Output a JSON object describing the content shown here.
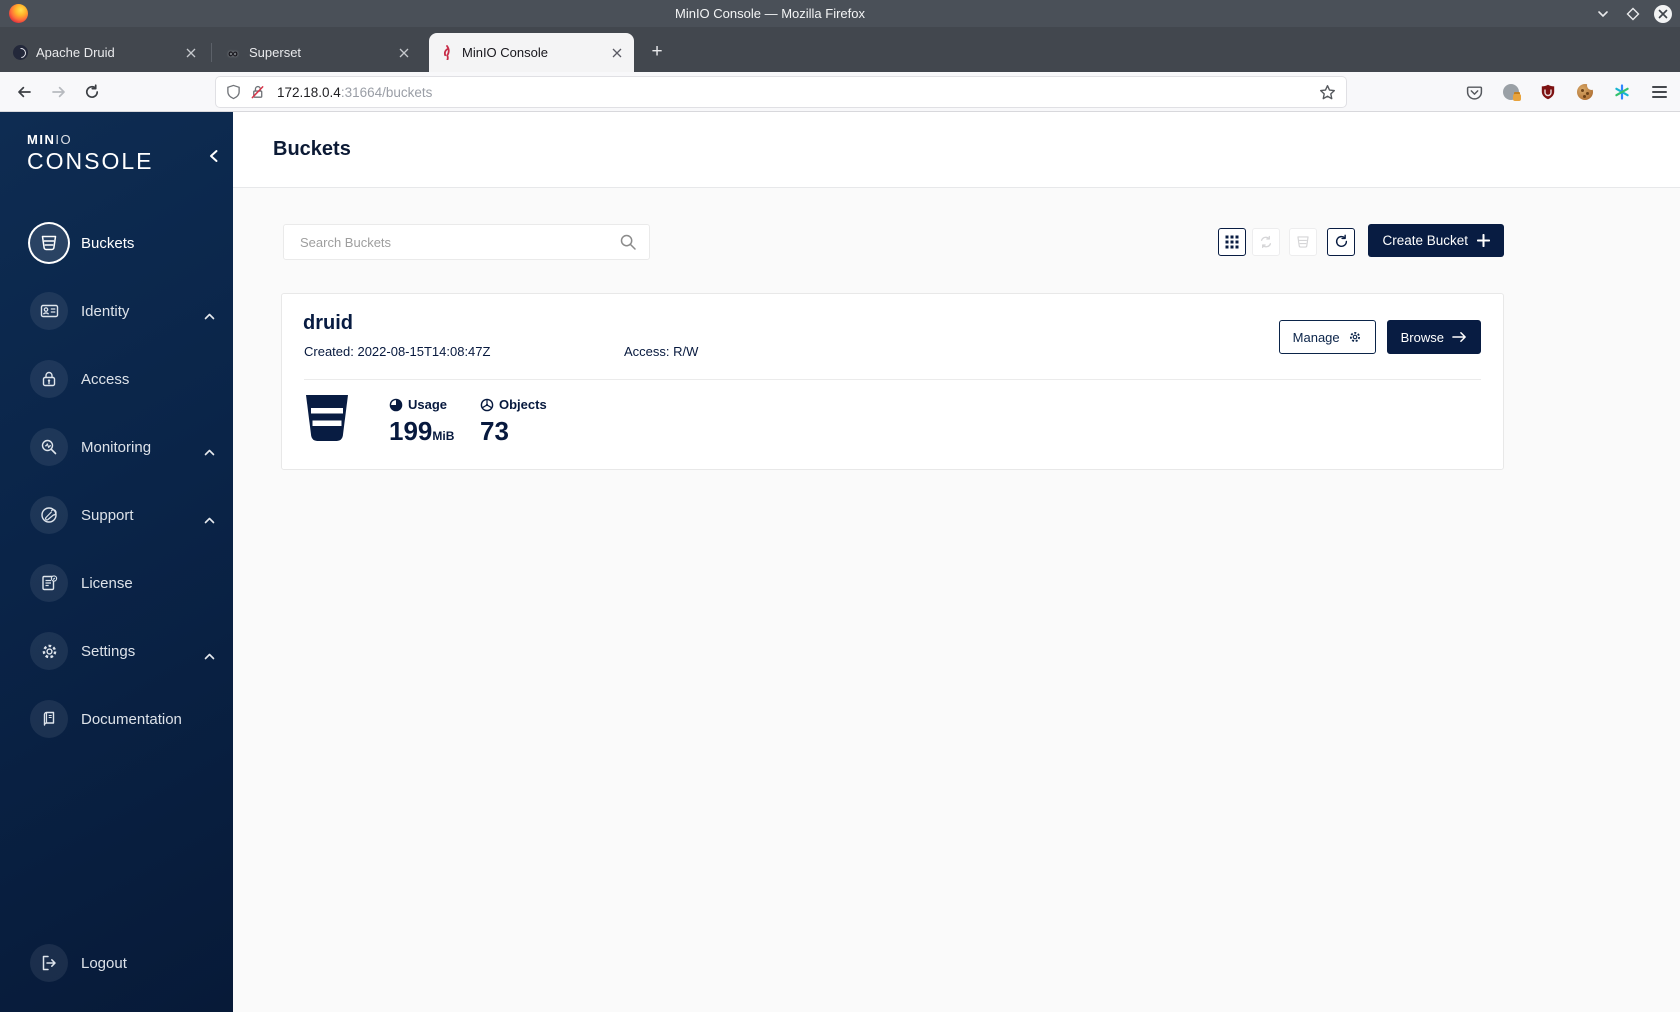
{
  "window": {
    "title": "MinIO Console — Mozilla Firefox"
  },
  "tabs": [
    {
      "label": "Apache Druid"
    },
    {
      "label": "Superset"
    },
    {
      "label": "MinIO Console"
    }
  ],
  "navbar": {
    "url_host": "172.18.0.4",
    "url_path": ":31664/buckets"
  },
  "icons": {
    "superset_infinity": "∞",
    "new_tab_plus": "+"
  },
  "sidebar": {
    "brand_bold": "MIN",
    "brand_light": "IO",
    "product": "CONSOLE",
    "items": [
      {
        "label": "Buckets"
      },
      {
        "label": "Identity"
      },
      {
        "label": "Access"
      },
      {
        "label": "Monitoring"
      },
      {
        "label": "Support"
      },
      {
        "label": "License"
      },
      {
        "label": "Settings"
      },
      {
        "label": "Documentation"
      }
    ],
    "logout_label": "Logout"
  },
  "page": {
    "title": "Buckets",
    "search_placeholder": "Search Buckets",
    "create_button_label": "Create Bucket",
    "bucket": {
      "name": "druid",
      "created": "Created: 2022-08-15T14:08:47Z",
      "access": "Access: R/W",
      "manage_label": "Manage",
      "browse_label": "Browse",
      "usage_label": "Usage",
      "usage_value": "199",
      "usage_unit": "MiB",
      "objects_label": "Objects",
      "objects_value": "73"
    }
  },
  "colors": {
    "brand_navy": "#081C42",
    "minio_red": "#C72C48",
    "sidebar_top": "#0E2C52",
    "sidebar_bottom": "#071A38"
  }
}
